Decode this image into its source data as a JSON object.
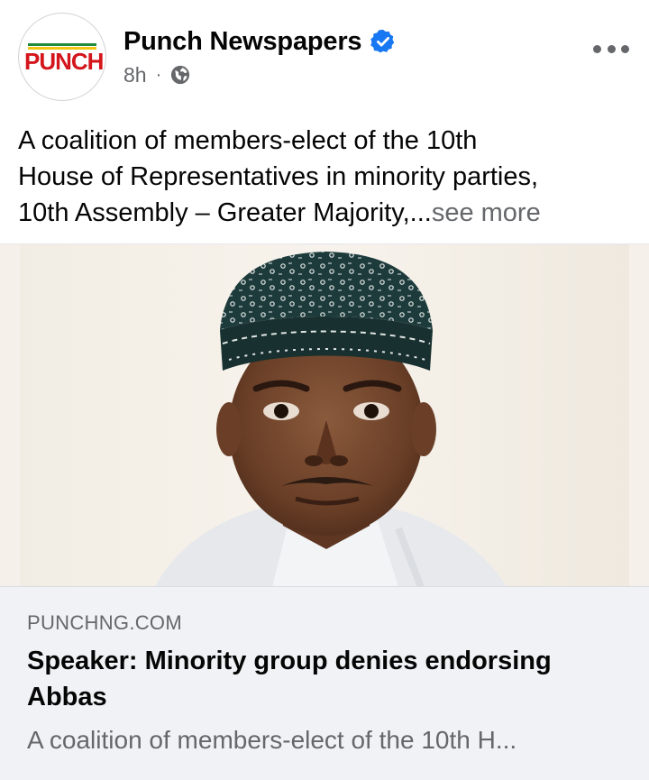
{
  "post": {
    "page_name": "Punch Newspapers",
    "avatar_logo_text": "PUNCH",
    "time_ago": "8h",
    "meta_separator": "·",
    "privacy_icon": "globe-icon",
    "verified_icon": "verified-badge-icon",
    "more_icon": "more-options-icon",
    "text_lines": [
      "A coalition of members-elect of the 10th",
      "House of Representatives in minority parties,",
      "10th Assembly – Greater Majority,..."
    ],
    "see_more_label": "see more"
  },
  "link_preview": {
    "domain": "PUNCHNG.COM",
    "title": "Speaker: Minority group denies endorsing Abbas",
    "description": "A coalition of members-elect of the 10th H..."
  },
  "colors": {
    "verified_blue": "#1877f2",
    "secondary_text": "#65676b",
    "link_card_bg": "#f0f2f5",
    "punch_red": "#d4161c"
  }
}
